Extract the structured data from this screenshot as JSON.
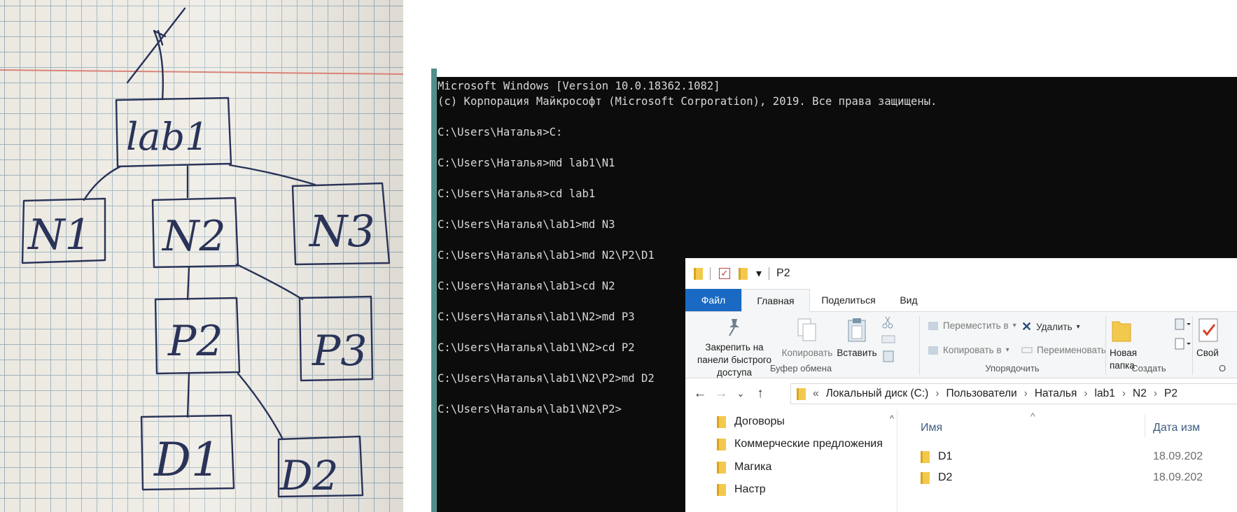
{
  "photo": {
    "nodes": {
      "root": "lab1",
      "n1": "N1",
      "n2": "N2",
      "n3": "N3",
      "p2": "P2",
      "p3": "P3",
      "d1": "D1",
      "d2": "D2"
    }
  },
  "console": {
    "lines": [
      "Microsoft Windows [Version 10.0.18362.1082]",
      "(c) Корпорация Майкрософт (Microsoft Corporation), 2019. Все права защищены.",
      "",
      "C:\\Users\\Наталья>C:",
      "",
      "C:\\Users\\Наталья>md lab1\\N1",
      "",
      "C:\\Users\\Наталья>cd lab1",
      "",
      "C:\\Users\\Наталья\\lab1>md N3",
      "",
      "C:\\Users\\Наталья\\lab1>md N2\\P2\\D1",
      "",
      "C:\\Users\\Наталья\\lab1>cd N2",
      "",
      "C:\\Users\\Наталья\\lab1\\N2>md P3",
      "",
      "C:\\Users\\Наталья\\lab1\\N2>cd P2",
      "",
      "C:\\Users\\Наталья\\lab1\\N2\\P2>md D2",
      "",
      "C:\\Users\\Наталья\\lab1\\N2\\P2>"
    ]
  },
  "explorer": {
    "title": "P2",
    "quick_access_dropdown": "▾",
    "tabs": {
      "file": "Файл",
      "home": "Главная",
      "share": "Поделиться",
      "view": "Вид"
    },
    "ribbon": {
      "pin": "Закрепить на панели быстрого доступа",
      "copy": "Копировать",
      "paste": "Вставить",
      "clipboard_group": "Буфер обмена",
      "move_to": "Переместить в",
      "copy_to": "Копировать в",
      "delete": "Удалить",
      "rename": "Переименовать",
      "organize_group": "Упорядочить",
      "new_folder": "Новая папка",
      "create_group": "Создать",
      "properties": "Свой",
      "open_group_partial": "О"
    },
    "address": {
      "overflow": "«",
      "crumbs": [
        "Локальный диск (C:)",
        "Пользователи",
        "Наталья",
        "lab1",
        "N2",
        "P2"
      ]
    },
    "nav_pane": [
      "Договоры",
      "Коммерческие предложения",
      "Магика",
      "Настр"
    ],
    "columns": {
      "name": "Имя",
      "date": "Дата изм"
    },
    "files": [
      {
        "name": "D1",
        "date": "18.09.202"
      },
      {
        "name": "D2",
        "date": "18.09.202"
      }
    ]
  }
}
